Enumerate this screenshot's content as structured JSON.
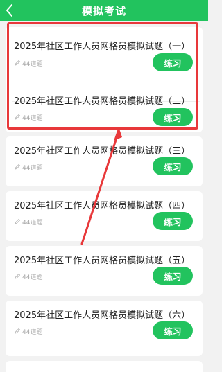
{
  "header": {
    "title": "模拟考试"
  },
  "exams": [
    {
      "title": "2025年社区工作人员网格员模拟试题（一）",
      "count": "44道题",
      "button": "练习"
    },
    {
      "title": "2025年社区工作人员网格员模拟试题（二）",
      "count": "44道题",
      "button": "练习"
    },
    {
      "title": "2025年社区工作人员网格员模拟试题（三）",
      "count": "44道题",
      "button": "练习"
    },
    {
      "title": "2025年社区工作人员网格员模拟试题（四）",
      "count": "44道题",
      "button": "练习"
    },
    {
      "title": "2025年社区工作人员网格员模拟试题（五）",
      "count": "44道题",
      "button": "练习"
    },
    {
      "title": "2025年社区工作人员网格员模拟试题（六）",
      "count": "44道题",
      "button": "练习"
    }
  ],
  "colors": {
    "accent": "#22c35e",
    "highlight": "#e8383a"
  },
  "icons": {
    "back": "chevron-left-icon",
    "count": "pencil-icon"
  }
}
